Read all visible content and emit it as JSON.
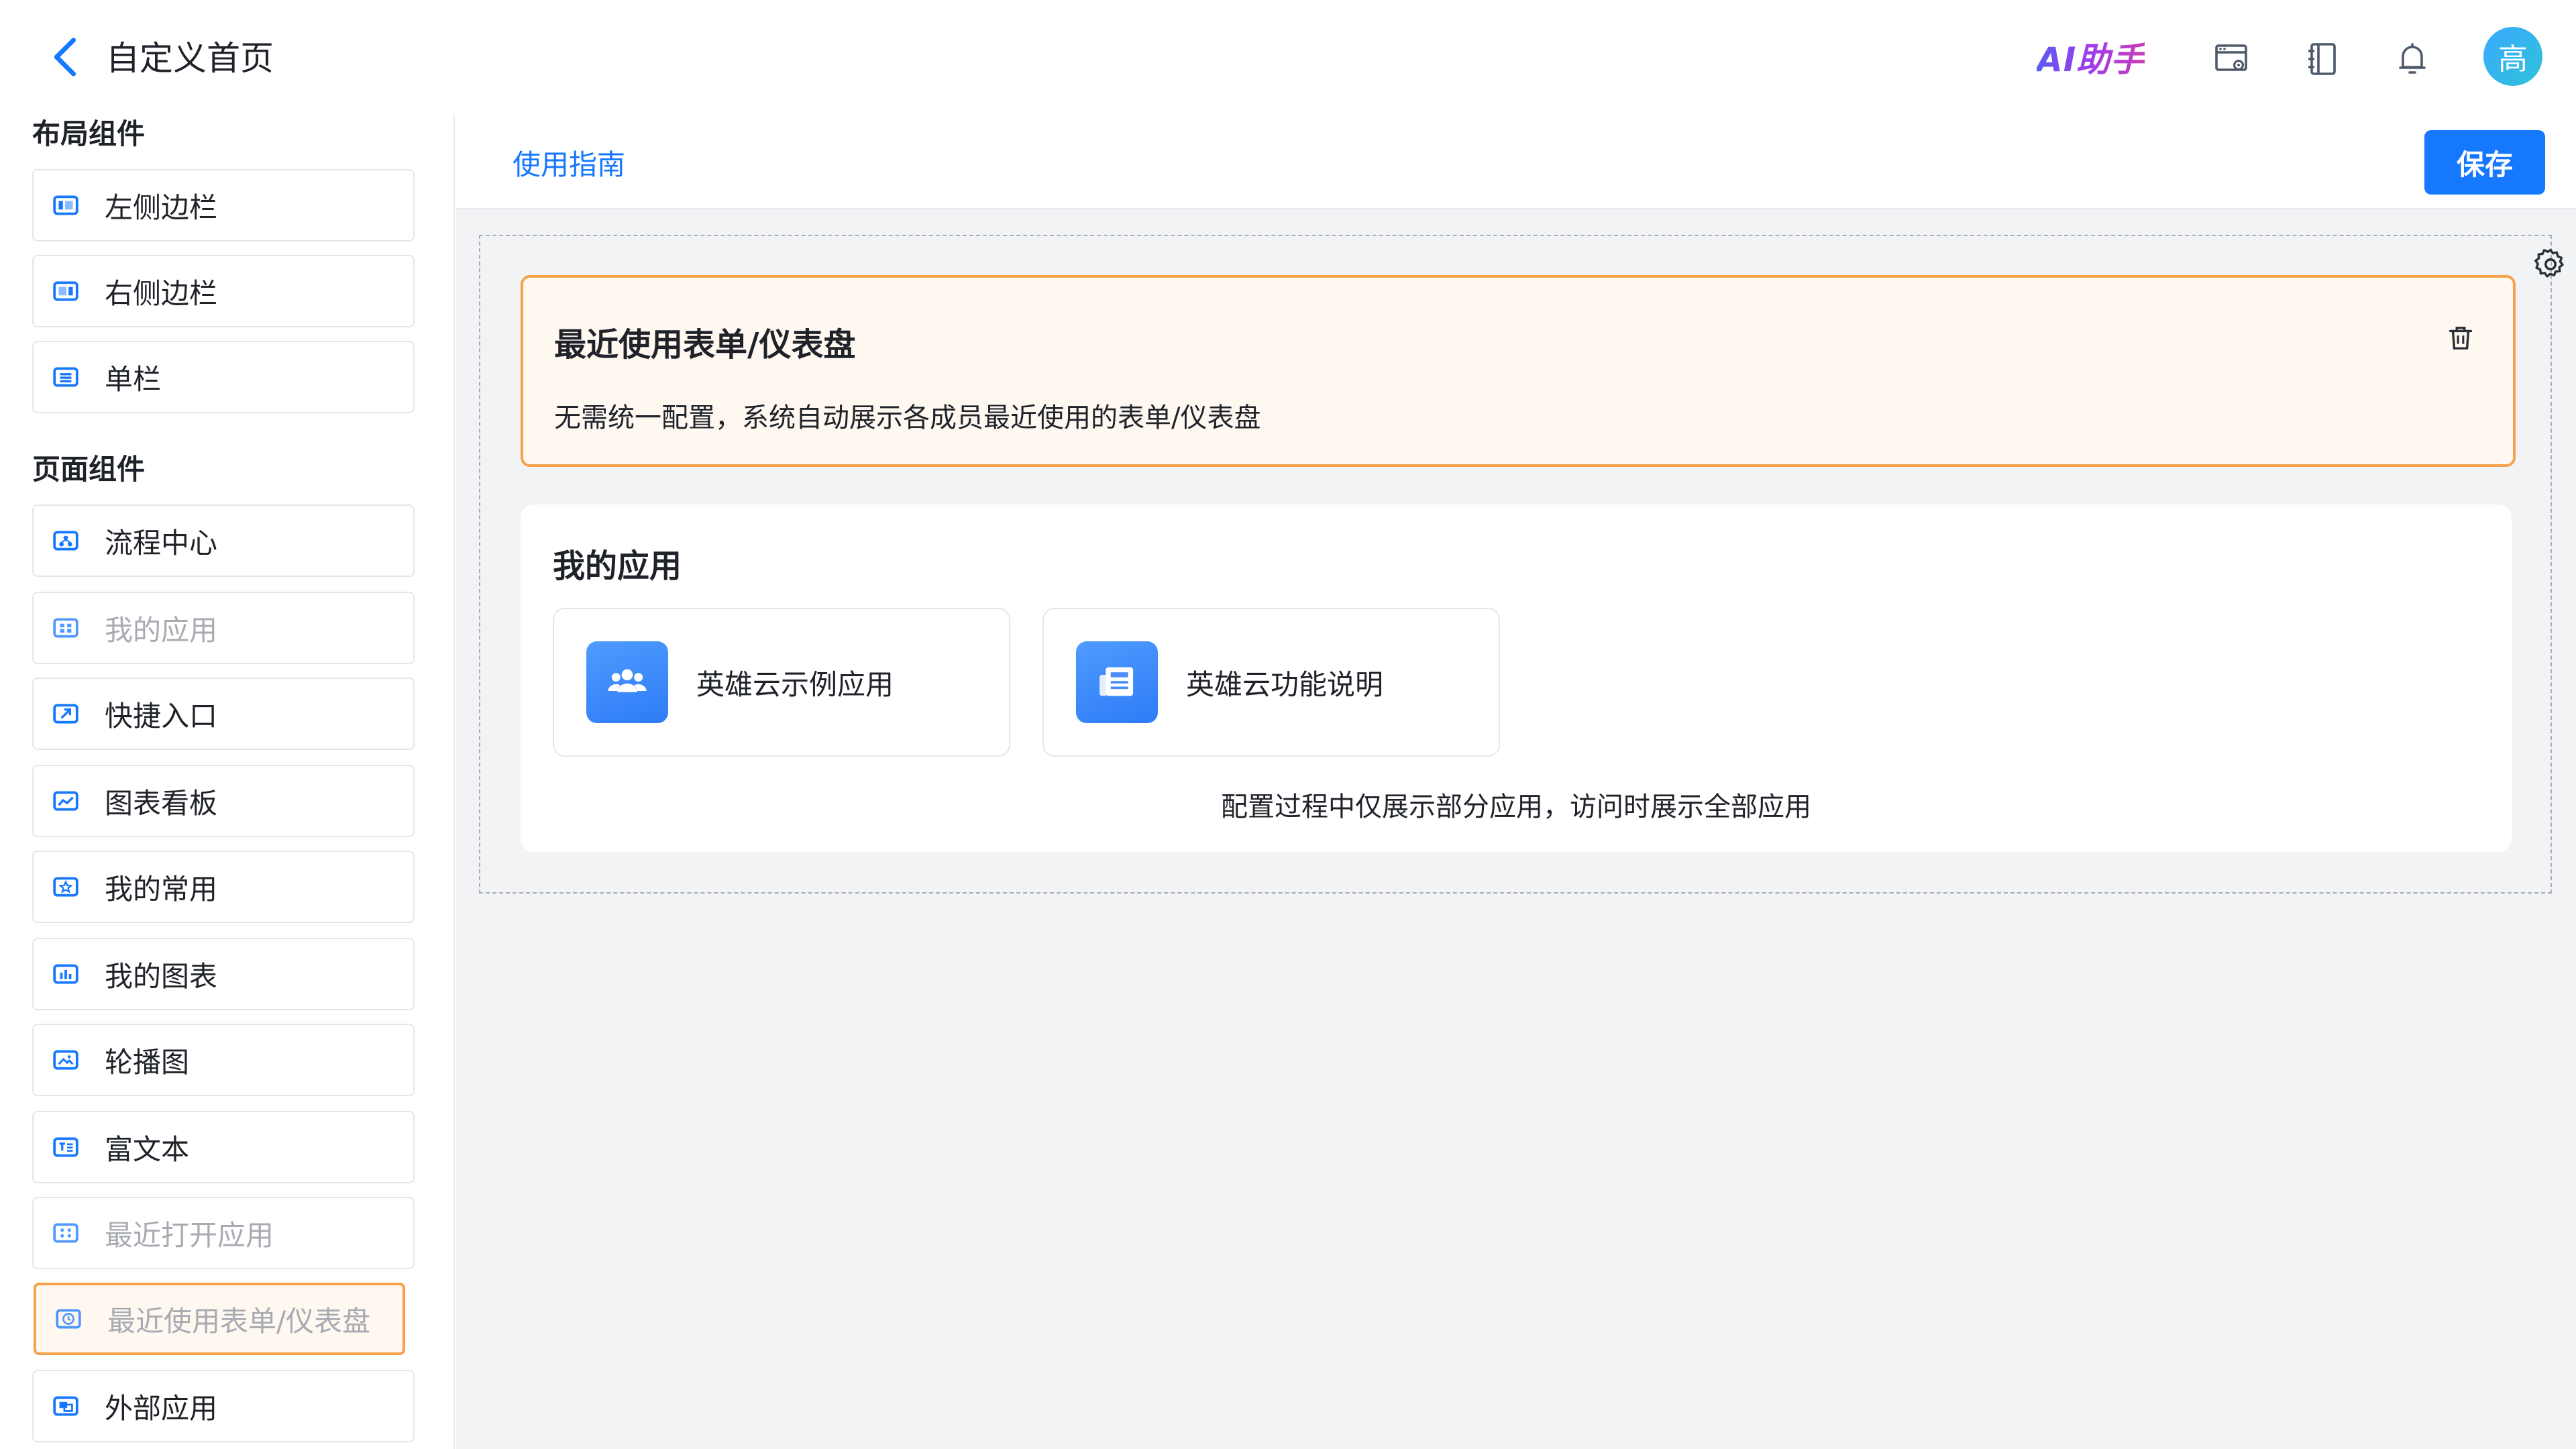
{
  "header": {
    "title": "自定义首页",
    "ai_label": "AI助手",
    "avatar_text": "高",
    "icons": [
      "back-chevron-icon",
      "window-settings-icon",
      "book-icon",
      "bell-icon"
    ]
  },
  "left_panel": {
    "layout_title": "布局组件",
    "layout_items": [
      {
        "label": "左侧边栏",
        "icon": "left-sidebar-layout-icon"
      },
      {
        "label": "右侧边栏",
        "icon": "right-sidebar-layout-icon"
      },
      {
        "label": "单栏",
        "icon": "single-column-layout-icon"
      }
    ],
    "page_title": "页面组件",
    "page_items": [
      {
        "label": "流程中心",
        "icon": "workflow-icon",
        "disabled": false
      },
      {
        "label": "我的应用",
        "icon": "apps-grid-icon",
        "disabled": true
      },
      {
        "label": "快捷入口",
        "icon": "shortcut-icon",
        "disabled": false
      },
      {
        "label": "图表看板",
        "icon": "line-chart-icon",
        "disabled": false
      },
      {
        "label": "我的常用",
        "icon": "star-icon",
        "disabled": false
      },
      {
        "label": "我的图表",
        "icon": "bar-chart-icon",
        "disabled": false
      },
      {
        "label": "轮播图",
        "icon": "carousel-icon",
        "disabled": false
      },
      {
        "label": "富文本",
        "icon": "rich-text-icon",
        "disabled": false
      },
      {
        "label": "最近打开应用",
        "icon": "recent-apps-icon",
        "disabled": true
      },
      {
        "label": "最近使用表单/仪表盘",
        "icon": "clock-icon",
        "disabled": true,
        "selected": true
      },
      {
        "label": "外部应用",
        "icon": "external-app-icon",
        "disabled": false
      }
    ]
  },
  "toolbar": {
    "guide_label": "使用指南",
    "save_label": "保存"
  },
  "canvas": {
    "recent": {
      "title": "最近使用表单/仪表盘",
      "desc": "无需统一配置，系统自动展示各成员最近使用的表单/仪表盘"
    },
    "apps": {
      "title": "我的应用",
      "items": [
        {
          "name": "英雄云示例应用",
          "icon": "team-icon"
        },
        {
          "name": "英雄云功能说明",
          "icon": "newspaper-icon"
        }
      ],
      "note": "配置过程中仅展示部分应用，访问时展示全部应用"
    }
  },
  "colors": {
    "primary": "#1677ff",
    "selected_border": "#f7a24a",
    "selected_bg": "#fff8f1",
    "canvas_bg": "#f2f3f5",
    "disabled_text": "#a8abb2"
  }
}
